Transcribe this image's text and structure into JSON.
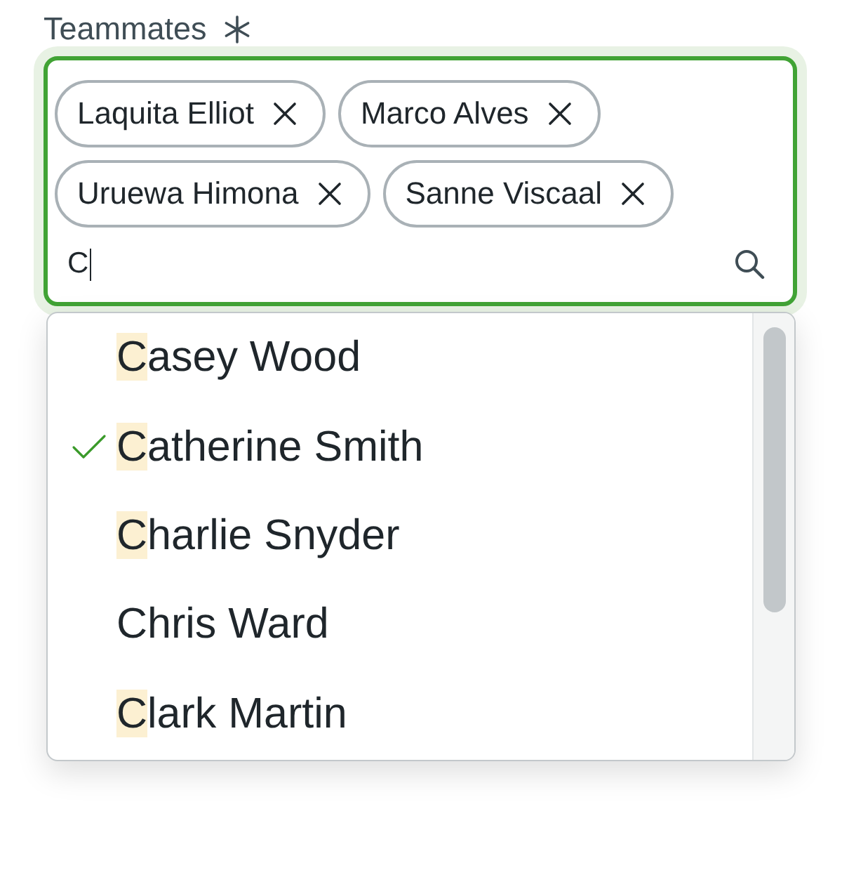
{
  "field": {
    "label": "Teammates",
    "required": true,
    "focused": true,
    "chips": [
      {
        "label": "Laquita Elliot"
      },
      {
        "label": "Marco Alves"
      },
      {
        "label": "Uruewa Himona"
      },
      {
        "label": "Sanne Viscaal"
      }
    ],
    "value": "C"
  },
  "options": [
    {
      "label": "Casey Wood",
      "selected": false,
      "match_highlighted": true
    },
    {
      "label": "Catherine Smith",
      "selected": true,
      "match_highlighted": true
    },
    {
      "label": "Charlie Snyder",
      "selected": false,
      "match_highlighted": true
    },
    {
      "label": "Chris Ward",
      "selected": false,
      "match_highlighted": false
    },
    {
      "label": "Clark Martin",
      "selected": false,
      "match_highlighted": true
    }
  ]
}
